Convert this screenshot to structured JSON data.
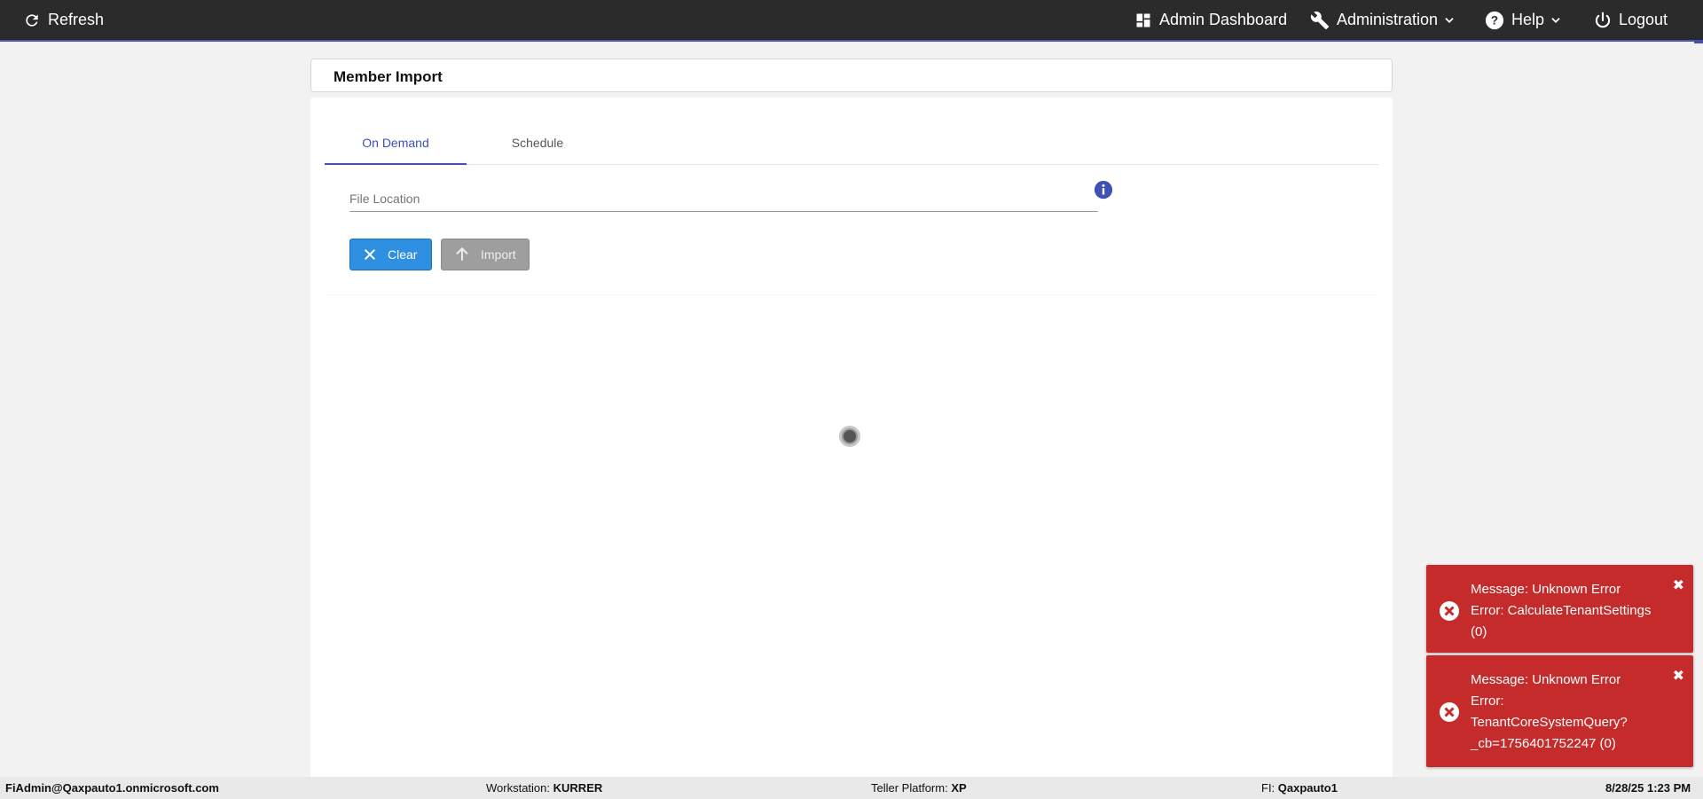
{
  "topbar": {
    "refresh_label": "Refresh",
    "admin_dashboard_label": "Admin Dashboard",
    "administration_label": "Administration",
    "help_label": "Help",
    "logout_label": "Logout"
  },
  "page": {
    "title": "Member Import"
  },
  "tabs": [
    {
      "label": "On Demand",
      "active": true
    },
    {
      "label": "Schedule",
      "active": false
    }
  ],
  "form": {
    "file_location_placeholder": "File Location",
    "file_location_value": ""
  },
  "buttons": {
    "clear_label": "Clear",
    "import_label": "Import"
  },
  "toasts": [
    {
      "lines": [
        "Message: Unknown Error",
        "Error: CalculateTenantSettings",
        "(0)"
      ]
    },
    {
      "lines": [
        "Message: Unknown Error",
        "Error:",
        "TenantCoreSystemQuery?",
        "_cb=1756401752247 (0)"
      ]
    }
  ],
  "statusbar": {
    "user": "FiAdmin@Qaxpauto1.onmicrosoft.com",
    "workstation_label": "Workstation:",
    "workstation_value": "KURRER",
    "teller_label": "Teller Platform:",
    "teller_value": "XP",
    "fi_label": "FI:",
    "fi_value": "Qaxpauto1",
    "datetime": "8/28/25 1:23 PM"
  },
  "colors": {
    "topbar": "#2b2b2b",
    "accent": "#3f51b5",
    "clear_button": "#2f8fe0",
    "toast_error": "#c62b2b"
  }
}
